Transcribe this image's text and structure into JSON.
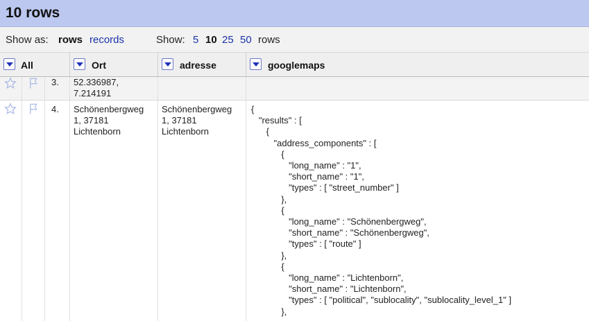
{
  "header": {
    "row_count": "10 rows"
  },
  "view_bar": {
    "show_as_label": "Show as:",
    "rows_label": "rows",
    "records_label": "records",
    "show_label": "Show:",
    "page_sizes": [
      "5",
      "10",
      "25",
      "50"
    ],
    "selected_page_size": "10",
    "rows_suffix": "rows"
  },
  "columns": [
    {
      "name": "All"
    },
    {
      "name": "Ort"
    },
    {
      "name": "adresse"
    },
    {
      "name": "googlemaps"
    }
  ],
  "rows": [
    {
      "number": "3.",
      "ort_line1": "52.336987,",
      "ort_line2": "7.214191"
    },
    {
      "number": "4.",
      "ort_line1": "Schönenbergweg",
      "ort_line2": "1, 37181",
      "ort_line3": "Lichtenborn",
      "adresse_line1": "Schönenbergweg",
      "adresse_line2": "1, 37181",
      "adresse_line3": "Lichtenborn",
      "googlemaps_json": "{\n   \"results\" : [\n      {\n         \"address_components\" : [\n            {\n               \"long_name\" : \"1\",\n               \"short_name\" : \"1\",\n               \"types\" : [ \"street_number\" ]\n            },\n            {\n               \"long_name\" : \"Schönenbergweg\",\n               \"short_name\" : \"Schönenbergweg\",\n               \"types\" : [ \"route\" ]\n            },\n            {\n               \"long_name\" : \"Lichtenborn\",\n               \"short_name\" : \"Lichtenborn\",\n               \"types\" : [ \"political\", \"sublocality\", \"sublocality_level_1\" ]\n            },"
    }
  ],
  "colors": {
    "header_bg": "#bcc8f0",
    "link": "#1a33a8",
    "dropdown_arrow": "#2232b8",
    "star_flag": "#a9b8e6"
  },
  "icons": {
    "star": "star-icon",
    "flag": "flag-icon",
    "dropdown": "chevron-down-icon"
  }
}
